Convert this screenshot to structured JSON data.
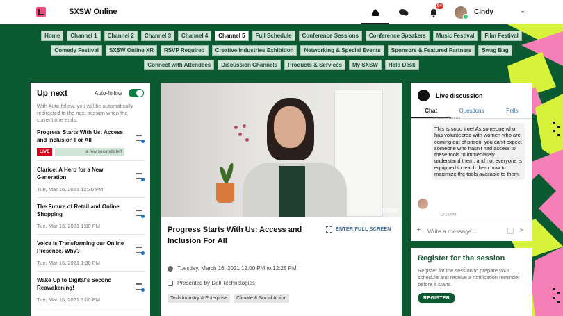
{
  "header": {
    "app_title": "SXSW Online",
    "notification_count": "9+",
    "user_name": "Cindy"
  },
  "channels": [
    {
      "label": "Home",
      "active": false
    },
    {
      "label": "Channel 1",
      "active": false
    },
    {
      "label": "Channel 2",
      "active": false
    },
    {
      "label": "Channel 3",
      "active": false
    },
    {
      "label": "Channel 4",
      "active": false
    },
    {
      "label": "Channel 5",
      "active": true
    },
    {
      "label": "Full Schedule",
      "active": false
    },
    {
      "label": "Conference Sessions",
      "active": false
    },
    {
      "label": "Conference Speakers",
      "active": false
    },
    {
      "label": "Music Festival",
      "active": false
    },
    {
      "label": "Film Festival",
      "active": false
    },
    {
      "label": "Comedy Festival",
      "active": false
    },
    {
      "label": "SXSW Online XR",
      "active": false
    },
    {
      "label": "RSVP Required",
      "active": false
    },
    {
      "label": "Creative Industries Exhibition",
      "active": false
    },
    {
      "label": "Networking & Special Events",
      "active": false
    },
    {
      "label": "Sponsors & Featured Partners",
      "active": false
    },
    {
      "label": "Swag Bag",
      "active": false
    },
    {
      "label": "Connect with Attendees",
      "active": false
    },
    {
      "label": "Discussion Channels",
      "active": false
    },
    {
      "label": "Products & Services",
      "active": false
    },
    {
      "label": "My SXSW",
      "active": false
    },
    {
      "label": "Help Desk",
      "active": false
    }
  ],
  "up_next": {
    "title": "Up next",
    "autofollow_label": "Auto-follow",
    "autofollow_on": true,
    "description": "With Auto-follow, you will be automatically redirected to the next session when the current one ends.",
    "live_session": {
      "title": "Progress Starts With Us: Access and Inclusion For All",
      "live_badge": "LIVE",
      "countdown": "a few seconds left"
    },
    "sessions": [
      {
        "title": "Clarice: A Hero for a New Generation",
        "time": "Tue, Mar 16, 2021 12:30 PM"
      },
      {
        "title": "The Future of Retail and Online Shopping",
        "time": "Tue, Mar 16, 2021 1:00 PM"
      },
      {
        "title": "Voice is Transforming our Online Presence. Why?",
        "time": "Tue, Mar 16, 2021 1:30 PM"
      },
      {
        "title": "Wake Up to Digital's Second Reawakening!",
        "time": "Tue, Mar 16, 2021 3:00 PM"
      }
    ]
  },
  "session": {
    "video_watermark": "SXSW",
    "title": "Progress Starts With Us: Access and Inclusion For All",
    "fullscreen_label": "ENTER FULL SCREEN",
    "datetime": "Tuesday, March 16, 2021 12:00 PM to 12:25 PM",
    "presenter": "Presented by Dell Technologies",
    "tags": [
      "Tech Industry & Enterprise",
      "Climate & Social Action"
    ]
  },
  "discussion": {
    "title": "Live discussion",
    "tabs": [
      "Chat",
      "Questions",
      "Polls"
    ],
    "message_author": "Kristen Bennet",
    "message_text": "This is sooo true! As someone who has volunteered with women who are coming out of prison, you can't expect someone who hasn't had access to these tools to immediately understand them, and not everyone is equipped to teach them how to maximize the tools available to them.",
    "message_time": "12:24 PM",
    "composer_placeholder": "Write a message..."
  },
  "register": {
    "title": "Register for the session",
    "description": "Register for the session to prepare your schedule and receive a notification reminder before it starts.",
    "button_label": "REGISTER"
  },
  "colors": {
    "background_green": "#0b5a31",
    "chip_bg": "#cfe3d6",
    "live_red": "#d0021b",
    "accent_pink": "#f77fb8",
    "accent_lime": "#d6f23a"
  }
}
